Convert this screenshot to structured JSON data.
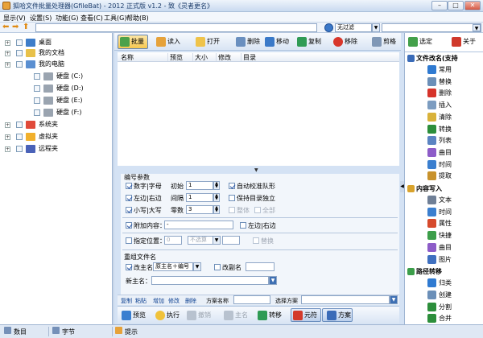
{
  "window": {
    "title": "狐哈文件批量处理器(GfileBat) - 2012 正式版 v1.2 - 致《灵者更名》"
  },
  "menu": [
    "显示(V)",
    "设置(S)",
    "功能(G)",
    "查看(C)",
    "工具(G)",
    "帮助(B)"
  ],
  "address": {
    "path": "",
    "filter_value": "无过滤",
    "filter2_value": ""
  },
  "tree": {
    "items": [
      {
        "label": "桌面",
        "indent": 0,
        "icon_color": "#3e7dc9"
      },
      {
        "label": "我的文档",
        "indent": 0,
        "icon_color": "#e8c14a"
      },
      {
        "label": "我的电脑",
        "indent": 0,
        "icon_color": "#5a8fd1"
      },
      {
        "label": "硬盘 (C:)",
        "indent": 1,
        "icon_color": "#9aa4b0"
      },
      {
        "label": "硬盘 (D:)",
        "indent": 1,
        "icon_color": "#9aa4b0"
      },
      {
        "label": "硬盘 (E:)",
        "indent": 1,
        "icon_color": "#9aa4b0"
      },
      {
        "label": "硬盘 (F:)",
        "indent": 1,
        "icon_color": "#9aa4b0"
      },
      {
        "label": "系统夹",
        "indent": 0,
        "icon_color": "#e04a3a"
      },
      {
        "label": "虚拟夹",
        "indent": 0,
        "icon_color": "#f1b02c"
      },
      {
        "label": "远程夹",
        "indent": 0,
        "icon_color": "#4a62b8"
      }
    ]
  },
  "toolbar": {
    "batch": "批量",
    "read": "读入",
    "open": "打开",
    "delete": "删除",
    "move": "移动",
    "copy": "复制",
    "remove": "移除",
    "cut": "剪格",
    "select": "选定",
    "about": "关于"
  },
  "list": {
    "columns": [
      "名称",
      "预览",
      "大小",
      "修改",
      "目录"
    ]
  },
  "params": {
    "section_numbering": "编号参数",
    "digit_letter": "数字|字母",
    "start_label": "初始",
    "start_value": "1",
    "auto_fill": "自动校准队形",
    "left_right": "左边|右边",
    "interval_label": "间隔",
    "interval_value": "1",
    "keep_dir": "保持目录独立",
    "case": "小写|大写",
    "zero_label": "零数",
    "zero_value": "3",
    "whole": "整体",
    "all": "全部",
    "append_label": "附加内容：",
    "append_value": "-",
    "left_right2": "左边|右边",
    "position_label": "指定位置：",
    "position_value": "0",
    "position_select": "不选算",
    "replace": "替换",
    "section_rename": "重组文件名",
    "main_name_label": "改主名",
    "main_name_select": "原主名＋编号",
    "ext_label": "改副名",
    "new_name_label": "新主名："
  },
  "format_bar": {
    "items": [
      "复制",
      "粘贴",
      "增加",
      "修改",
      "删除"
    ],
    "scheme_name": "方案名称",
    "select_scheme": "选择方案"
  },
  "action_bar": {
    "preview": "预览",
    "execute": "执行",
    "undo": "撤销",
    "main": "主名",
    "convert": "转移",
    "preset": "元符",
    "scheme": "方案"
  },
  "right_panel": {
    "section1": "文件改名(支持",
    "items1": [
      {
        "label": "常用",
        "color": "#2f7ad1"
      },
      {
        "label": "替换",
        "color": "#6b8fb8"
      },
      {
        "label": "删除",
        "color": "#d6332a"
      },
      {
        "label": "插入",
        "color": "#7c9cc0"
      },
      {
        "label": "清除",
        "color": "#d9b23a"
      },
      {
        "label": "转换",
        "color": "#2c8e3b"
      },
      {
        "label": "列表",
        "color": "#5b84c2"
      },
      {
        "label": "曲目",
        "color": "#8d5cc8"
      },
      {
        "label": "时间",
        "color": "#3b7fcf"
      },
      {
        "label": "提取",
        "color": "#c8922c"
      }
    ],
    "section2": "内容写入",
    "items2": [
      {
        "label": "文本",
        "color": "#6f7f96"
      },
      {
        "label": "时间",
        "color": "#3b7fcf"
      },
      {
        "label": "属性",
        "color": "#d64a2c"
      },
      {
        "label": "快捷",
        "color": "#3c9e4a"
      },
      {
        "label": "曲目",
        "color": "#8d5cc8"
      },
      {
        "label": "图片",
        "color": "#3f70c0"
      }
    ],
    "section3": "路径转移",
    "items3": [
      {
        "label": "归类",
        "color": "#2f7ad1"
      },
      {
        "label": "创建",
        "color": "#6b8fb8"
      },
      {
        "label": "分割",
        "color": "#2c8e3b"
      },
      {
        "label": "合并",
        "color": "#2c8e3b"
      }
    ]
  },
  "status": {
    "items": "数目",
    "bytes": "字节",
    "hint": "提示"
  }
}
